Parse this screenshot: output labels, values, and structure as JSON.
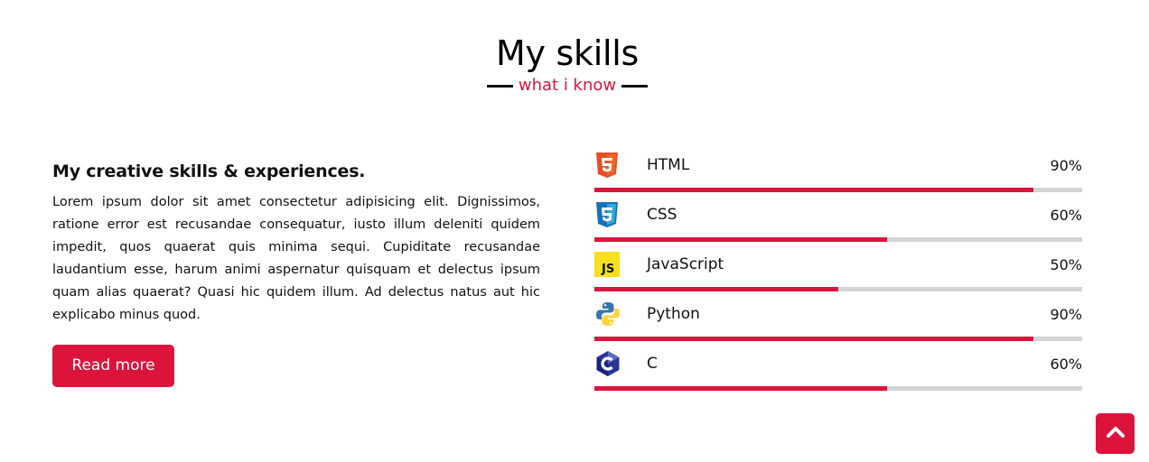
{
  "header": {
    "title": "My skills",
    "subtitle": "what i know"
  },
  "about": {
    "heading": "My creative skills & experiences.",
    "text": "Lorem ipsum dolor sit amet consectetur adipisicing elit. Dignissimos, ratione error est recusandae consequatur, iusto illum deleniti quidem impedit, quos quaerat quis minima sequi. Cupiditate recusandae laudantium esse, harum animi aspernatur quisquam et delectus ipsum quam alias quaerat? Quasi hic quidem illum. Ad delectus natus aut hic explicabo minus quod.",
    "button_label": "Read more"
  },
  "skills": [
    {
      "name": "HTML",
      "percent_label": "90%",
      "level": 90,
      "icon": "html5-icon"
    },
    {
      "name": "CSS",
      "percent_label": "60%",
      "level": 60,
      "icon": "css3-icon"
    },
    {
      "name": "JavaScript",
      "percent_label": "50%",
      "level": 50,
      "icon": "javascript-icon"
    },
    {
      "name": "Python",
      "percent_label": "90%",
      "level": 90,
      "icon": "python-icon"
    },
    {
      "name": "C",
      "percent_label": "60%",
      "level": 60,
      "icon": "c-language-icon"
    }
  ],
  "colors": {
    "accent": "#dc143c",
    "track": "#d4d4d4"
  },
  "scroll_top": {
    "icon": "chevron-up-icon"
  }
}
